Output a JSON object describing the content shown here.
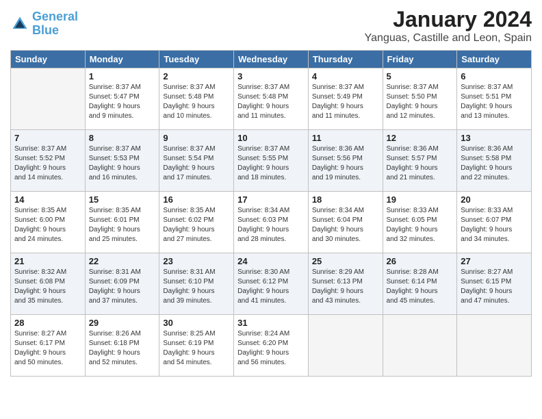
{
  "header": {
    "logo_line1": "General",
    "logo_line2": "Blue",
    "main_title": "January 2024",
    "subtitle": "Yanguas, Castille and Leon, Spain"
  },
  "calendar": {
    "headers": [
      "Sunday",
      "Monday",
      "Tuesday",
      "Wednesday",
      "Thursday",
      "Friday",
      "Saturday"
    ],
    "weeks": [
      [
        {
          "day": "",
          "info": ""
        },
        {
          "day": "1",
          "info": "Sunrise: 8:37 AM\nSunset: 5:47 PM\nDaylight: 9 hours\nand 9 minutes."
        },
        {
          "day": "2",
          "info": "Sunrise: 8:37 AM\nSunset: 5:48 PM\nDaylight: 9 hours\nand 10 minutes."
        },
        {
          "day": "3",
          "info": "Sunrise: 8:37 AM\nSunset: 5:48 PM\nDaylight: 9 hours\nand 11 minutes."
        },
        {
          "day": "4",
          "info": "Sunrise: 8:37 AM\nSunset: 5:49 PM\nDaylight: 9 hours\nand 11 minutes."
        },
        {
          "day": "5",
          "info": "Sunrise: 8:37 AM\nSunset: 5:50 PM\nDaylight: 9 hours\nand 12 minutes."
        },
        {
          "day": "6",
          "info": "Sunrise: 8:37 AM\nSunset: 5:51 PM\nDaylight: 9 hours\nand 13 minutes."
        }
      ],
      [
        {
          "day": "7",
          "info": "Sunrise: 8:37 AM\nSunset: 5:52 PM\nDaylight: 9 hours\nand 14 minutes."
        },
        {
          "day": "8",
          "info": "Sunrise: 8:37 AM\nSunset: 5:53 PM\nDaylight: 9 hours\nand 16 minutes."
        },
        {
          "day": "9",
          "info": "Sunrise: 8:37 AM\nSunset: 5:54 PM\nDaylight: 9 hours\nand 17 minutes."
        },
        {
          "day": "10",
          "info": "Sunrise: 8:37 AM\nSunset: 5:55 PM\nDaylight: 9 hours\nand 18 minutes."
        },
        {
          "day": "11",
          "info": "Sunrise: 8:36 AM\nSunset: 5:56 PM\nDaylight: 9 hours\nand 19 minutes."
        },
        {
          "day": "12",
          "info": "Sunrise: 8:36 AM\nSunset: 5:57 PM\nDaylight: 9 hours\nand 21 minutes."
        },
        {
          "day": "13",
          "info": "Sunrise: 8:36 AM\nSunset: 5:58 PM\nDaylight: 9 hours\nand 22 minutes."
        }
      ],
      [
        {
          "day": "14",
          "info": "Sunrise: 8:35 AM\nSunset: 6:00 PM\nDaylight: 9 hours\nand 24 minutes."
        },
        {
          "day": "15",
          "info": "Sunrise: 8:35 AM\nSunset: 6:01 PM\nDaylight: 9 hours\nand 25 minutes."
        },
        {
          "day": "16",
          "info": "Sunrise: 8:35 AM\nSunset: 6:02 PM\nDaylight: 9 hours\nand 27 minutes."
        },
        {
          "day": "17",
          "info": "Sunrise: 8:34 AM\nSunset: 6:03 PM\nDaylight: 9 hours\nand 28 minutes."
        },
        {
          "day": "18",
          "info": "Sunrise: 8:34 AM\nSunset: 6:04 PM\nDaylight: 9 hours\nand 30 minutes."
        },
        {
          "day": "19",
          "info": "Sunrise: 8:33 AM\nSunset: 6:05 PM\nDaylight: 9 hours\nand 32 minutes."
        },
        {
          "day": "20",
          "info": "Sunrise: 8:33 AM\nSunset: 6:07 PM\nDaylight: 9 hours\nand 34 minutes."
        }
      ],
      [
        {
          "day": "21",
          "info": "Sunrise: 8:32 AM\nSunset: 6:08 PM\nDaylight: 9 hours\nand 35 minutes."
        },
        {
          "day": "22",
          "info": "Sunrise: 8:31 AM\nSunset: 6:09 PM\nDaylight: 9 hours\nand 37 minutes."
        },
        {
          "day": "23",
          "info": "Sunrise: 8:31 AM\nSunset: 6:10 PM\nDaylight: 9 hours\nand 39 minutes."
        },
        {
          "day": "24",
          "info": "Sunrise: 8:30 AM\nSunset: 6:12 PM\nDaylight: 9 hours\nand 41 minutes."
        },
        {
          "day": "25",
          "info": "Sunrise: 8:29 AM\nSunset: 6:13 PM\nDaylight: 9 hours\nand 43 minutes."
        },
        {
          "day": "26",
          "info": "Sunrise: 8:28 AM\nSunset: 6:14 PM\nDaylight: 9 hours\nand 45 minutes."
        },
        {
          "day": "27",
          "info": "Sunrise: 8:27 AM\nSunset: 6:15 PM\nDaylight: 9 hours\nand 47 minutes."
        }
      ],
      [
        {
          "day": "28",
          "info": "Sunrise: 8:27 AM\nSunset: 6:17 PM\nDaylight: 9 hours\nand 50 minutes."
        },
        {
          "day": "29",
          "info": "Sunrise: 8:26 AM\nSunset: 6:18 PM\nDaylight: 9 hours\nand 52 minutes."
        },
        {
          "day": "30",
          "info": "Sunrise: 8:25 AM\nSunset: 6:19 PM\nDaylight: 9 hours\nand 54 minutes."
        },
        {
          "day": "31",
          "info": "Sunrise: 8:24 AM\nSunset: 6:20 PM\nDaylight: 9 hours\nand 56 minutes."
        },
        {
          "day": "",
          "info": ""
        },
        {
          "day": "",
          "info": ""
        },
        {
          "day": "",
          "info": ""
        }
      ]
    ]
  }
}
